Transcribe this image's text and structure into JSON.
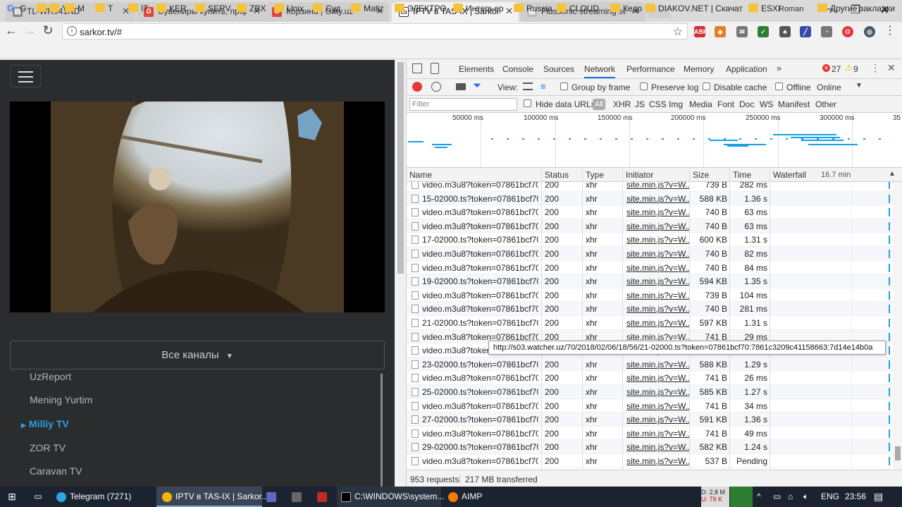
{
  "browser": {
    "tabs": [
      {
        "title": "TL-WR941ND"
      },
      {
        "title": "Сувениры купить, прод"
      },
      {
        "title": "Корзина | Gifty.uz"
      },
      {
        "title": "IPTV в TAS-IX | SarkorTV"
      },
      {
        "title": "Flussonic streaming serv"
      }
    ],
    "user": "Roman",
    "url": "sarkor.tv/#",
    "bookmarks": [
      "G",
      "Я",
      "Y",
      "M",
      "T",
      "IT",
      "KER",
      "SERV",
      "ZBX",
      "Unix",
      "Суд",
      "Matiz",
      "ЭЛЕКТРО",
      "Интерьер",
      "Russia",
      "CLOUD",
      "Кедр",
      "DIAKOV.NET | Скачат",
      "ESXI"
    ],
    "other_bookmarks": "Другие закладки"
  },
  "page": {
    "channels_button": "Все каналы",
    "channels": [
      "UzReport",
      "Mening Yurtim",
      "Milliy TV",
      "ZOR TV",
      "Caravan TV"
    ],
    "active_channel": "Milliy TV"
  },
  "devtools": {
    "tabs": [
      "Elements",
      "Console",
      "Sources",
      "Network",
      "Performance",
      "Memory",
      "Application"
    ],
    "errors": "27",
    "warnings": "9",
    "view_label": "View:",
    "group_by_frame": "Group by frame",
    "preserve_log": "Preserve log",
    "disable_cache": "Disable cache",
    "offline": "Offline",
    "online": "Online",
    "filter_placeholder": "Filter",
    "hide_data_urls": "Hide data URLs",
    "type_filters": [
      "All",
      "XHR",
      "JS",
      "CSS",
      "Img",
      "Media",
      "Font",
      "Doc",
      "WS",
      "Manifest",
      "Other"
    ],
    "timeline_ticks": [
      "50000 ms",
      "100000 ms",
      "150000 ms",
      "200000 ms",
      "250000 ms",
      "300000 ms",
      "35"
    ],
    "columns": [
      "Name",
      "Status",
      "Type",
      "Initiator",
      "Size",
      "Time",
      "Waterfall"
    ],
    "waterfall_duration": "16.7 min",
    "rows": [
      {
        "name": "video.m3u8?token=07861bcf70...",
        "status": "200",
        "type": "xhr",
        "initiator": "site.min.js?v=W...",
        "size": "739 B",
        "time": "282 ms"
      },
      {
        "name": "15-02000.ts?token=07861bcf70...",
        "status": "200",
        "type": "xhr",
        "initiator": "site.min.js?v=W...",
        "size": "588 KB",
        "time": "1.36 s"
      },
      {
        "name": "video.m3u8?token=07861bcf70...",
        "status": "200",
        "type": "xhr",
        "initiator": "site.min.js?v=W...",
        "size": "740 B",
        "time": "63 ms"
      },
      {
        "name": "video.m3u8?token=07861bcf70...",
        "status": "200",
        "type": "xhr",
        "initiator": "site.min.js?v=W...",
        "size": "740 B",
        "time": "63 ms"
      },
      {
        "name": "17-02000.ts?token=07861bcf70...",
        "status": "200",
        "type": "xhr",
        "initiator": "site.min.js?v=W...",
        "size": "600 KB",
        "time": "1.31 s"
      },
      {
        "name": "video.m3u8?token=07861bcf70...",
        "status": "200",
        "type": "xhr",
        "initiator": "site.min.js?v=W...",
        "size": "740 B",
        "time": "82 ms"
      },
      {
        "name": "video.m3u8?token=07861bcf70...",
        "status": "200",
        "type": "xhr",
        "initiator": "site.min.js?v=W...",
        "size": "740 B",
        "time": "84 ms"
      },
      {
        "name": "19-02000.ts?token=07861bcf70...",
        "status": "200",
        "type": "xhr",
        "initiator": "site.min.js?v=W...",
        "size": "594 KB",
        "time": "1.35 s"
      },
      {
        "name": "video.m3u8?token=07861bcf70...",
        "status": "200",
        "type": "xhr",
        "initiator": "site.min.js?v=W...",
        "size": "739 B",
        "time": "104 ms"
      },
      {
        "name": "video.m3u8?token=07861bcf70...",
        "status": "200",
        "type": "xhr",
        "initiator": "site.min.js?v=W...",
        "size": "740 B",
        "time": "281 ms"
      },
      {
        "name": "21-02000.ts?token=07861bcf70...",
        "status": "200",
        "type": "xhr",
        "initiator": "site.min.js?v=W...",
        "size": "597 KB",
        "time": "1.31 s"
      },
      {
        "name": "video.m3u8?token=07861bcf70...",
        "status": "200",
        "type": "xhr",
        "initiator": "site.min.js?v=W...",
        "size": "741 B",
        "time": "29 ms"
      },
      {
        "name": "video.m3u8?token=07861bcf70...",
        "status": "200",
        "type": "xhr",
        "initiator": "site.min.js?v=W...",
        "size": "",
        "time": ""
      },
      {
        "name": "23-02000.ts?token=07861bcf70...",
        "status": "200",
        "type": "xhr",
        "initiator": "site.min.js?v=W...",
        "size": "588 KB",
        "time": "1.29 s"
      },
      {
        "name": "video.m3u8?token=07861bcf70...",
        "status": "200",
        "type": "xhr",
        "initiator": "site.min.js?v=W...",
        "size": "741 B",
        "time": "26 ms"
      },
      {
        "name": "25-02000.ts?token=07861bcf70...",
        "status": "200",
        "type": "xhr",
        "initiator": "site.min.js?v=W...",
        "size": "585 KB",
        "time": "1.27 s"
      },
      {
        "name": "video.m3u8?token=07861bcf70...",
        "status": "200",
        "type": "xhr",
        "initiator": "site.min.js?v=W...",
        "size": "741 B",
        "time": "34 ms"
      },
      {
        "name": "27-02000.ts?token=07861bcf70...",
        "status": "200",
        "type": "xhr",
        "initiator": "site.min.js?v=W...",
        "size": "591 KB",
        "time": "1.36 s"
      },
      {
        "name": "video.m3u8?token=07861bcf70...",
        "status": "200",
        "type": "xhr",
        "initiator": "site.min.js?v=W...",
        "size": "741 B",
        "time": "49 ms"
      },
      {
        "name": "29-02000.ts?token=07861bcf70...",
        "status": "200",
        "type": "xhr",
        "initiator": "site.min.js?v=W...",
        "size": "582 KB",
        "time": "1.24 s"
      },
      {
        "name": "video.m3u8?token=07861bcf70...",
        "status": "200",
        "type": "xhr",
        "initiator": "site.min.js?v=W...",
        "size": "537 B",
        "time": "Pending"
      }
    ],
    "tooltip": "http://s03.watcher.uz/70/2018/02/06/18/56/21-02000.ts?token=07861bcf70:7861c3209c41158663:7d14e14b0a",
    "status_requests": "953 requests",
    "status_transferred": "217 MB transferred"
  },
  "taskbar": {
    "apps": [
      "Telegram (7271)",
      "IPTV в TAS-IX | Sarkor...",
      "C:\\WINDOWS\\system...",
      "AIMP"
    ],
    "net_down": "D: 2,8 M",
    "net_up": "U: 79 K",
    "lang": "ENG",
    "time": "23:56"
  },
  "colors": {
    "accent": "#1a73e8",
    "channel_active": "#2c9fe0",
    "waterfall": "#1ba1e2"
  }
}
